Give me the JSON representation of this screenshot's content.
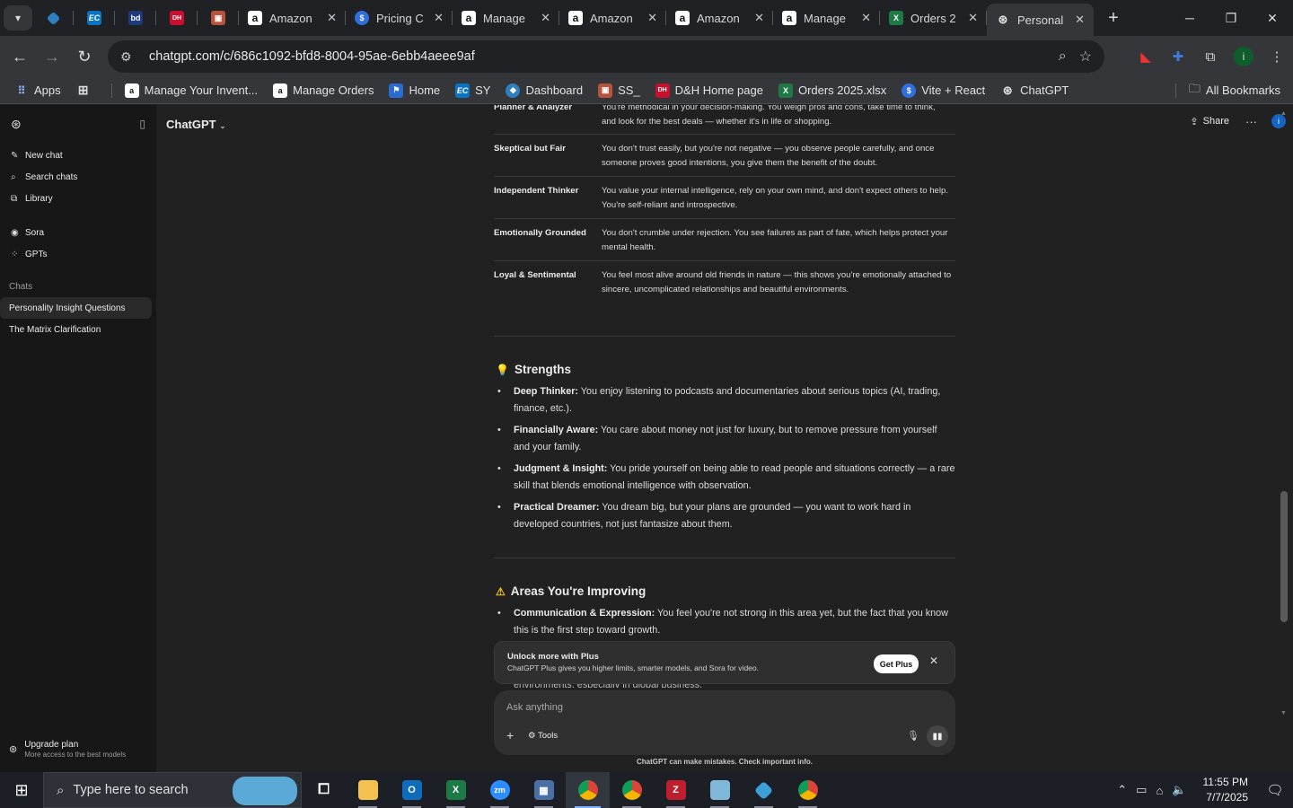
{
  "browser": {
    "tabs": [
      {
        "title": "Amazon",
        "icon": "amazon-icon"
      },
      {
        "title": "Pricing C",
        "icon": "dollar-icon"
      },
      {
        "title": "Manage",
        "icon": "amazon-icon"
      },
      {
        "title": "Amazon",
        "icon": "amazon-icon"
      },
      {
        "title": "Amazon",
        "icon": "amazon-icon"
      },
      {
        "title": "Manage",
        "icon": "amazon-icon"
      },
      {
        "title": "Orders 2",
        "icon": "excel-icon"
      },
      {
        "title": "Personal",
        "icon": "openai-icon",
        "active": true
      }
    ],
    "pinned_tabs": [
      "kite-icon",
      "ec-icon",
      "bd-icon",
      "dh-icon",
      "package-icon"
    ],
    "url": "chatgpt.com/c/686c1092-bfd8-8004-95ae-6ebb4aeee9af",
    "bookmarks": [
      {
        "label": "Apps",
        "icon": "apps-grid-icon"
      },
      {
        "label": "",
        "icon": "grid-icon"
      },
      {
        "label": "Manage Your Invent...",
        "icon": "amazon-icon"
      },
      {
        "label": "Manage Orders",
        "icon": "amazon-icon"
      },
      {
        "label": "Home",
        "icon": "home-flag-icon"
      },
      {
        "label": "SY",
        "icon": "ec-icon"
      },
      {
        "label": "Dashboard",
        "icon": "kite-icon"
      },
      {
        "label": "SS_",
        "icon": "package-icon"
      },
      {
        "label": "D&H Home page",
        "icon": "dh-icon"
      },
      {
        "label": "Orders 2025.xlsx",
        "icon": "excel-icon"
      },
      {
        "label": "Vite + React",
        "icon": "dollar-icon"
      },
      {
        "label": "ChatGPT",
        "icon": "openai-icon"
      }
    ],
    "all_bookmarks": "All Bookmarks",
    "profile_initial": "i"
  },
  "sidebar": {
    "items": [
      {
        "label": "New chat",
        "icon": "edit-icon"
      },
      {
        "label": "Search chats",
        "icon": "search-icon"
      },
      {
        "label": "Library",
        "icon": "library-icon"
      }
    ],
    "extras": [
      {
        "label": "Sora",
        "icon": "sora-icon"
      },
      {
        "label": "GPTs",
        "icon": "gpts-icon"
      }
    ],
    "chats_label": "Chats",
    "chats": [
      {
        "label": "Personality Insight Questions",
        "active": true
      },
      {
        "label": "The Matrix Clarification"
      }
    ],
    "upgrade_title": "Upgrade plan",
    "upgrade_sub": "More access to the best models"
  },
  "header": {
    "model": "ChatGPT",
    "share": "Share",
    "avatar": "i"
  },
  "traits": [
    {
      "name": "Planner & Analyzer",
      "desc": "You're methodical in your decision-making. You weigh pros and cons, take time to think, and look for the best deals — whether it's in life or shopping."
    },
    {
      "name": "Skeptical but Fair",
      "desc": "You don't trust easily, but you're not negative — you observe people carefully, and once someone proves good intentions, you give them the benefit of the doubt."
    },
    {
      "name": "Independent Thinker",
      "desc": "You value your internal intelligence, rely on your own mind, and don't expect others to help. You're self-reliant and introspective."
    },
    {
      "name": "Emotionally Grounded",
      "desc": "You don't crumble under rejection. You see failures as part of fate, which helps protect your mental health."
    },
    {
      "name": "Loyal & Sentimental",
      "desc": "You feel most alive around old friends in nature — this shows you're emotionally attached to sincere, uncomplicated relationships and beautiful environments."
    }
  ],
  "strengths": {
    "title": "Strengths",
    "emoji": "💡",
    "items": [
      {
        "label": "Deep Thinker:",
        "text": " You enjoy listening to podcasts and documentaries about serious topics (AI, trading, finance, etc.)."
      },
      {
        "label": "Financially Aware:",
        "text": " You care about money not just for luxury, but to remove pressure from yourself and your family."
      },
      {
        "label": "Judgment & Insight:",
        "text": " You pride yourself on being able to read people and situations correctly — a rare skill that blends emotional intelligence with observation."
      },
      {
        "label": "Practical Dreamer:",
        "text": " You dream big, but your plans are grounded — you want to work hard in developed countries, not just fantasize about them."
      }
    ]
  },
  "improving": {
    "title": "Areas You're Improving",
    "emoji": "⚠",
    "items": [
      {
        "label": "Communication & Expression:",
        "text": " You feel you're not strong in this area yet, but the fact that you know this is the first step toward growth."
      }
    ],
    "partial_text": "environments, especially in global business."
  },
  "promo": {
    "title": "Unlock more with Plus",
    "sub": "ChatGPT Plus gives you higher limits, smarter models, and Sora for video.",
    "button": "Get Plus"
  },
  "composer": {
    "placeholder": "Ask anything",
    "tools": "Tools",
    "disclaimer": "ChatGPT can make mistakes. Check important info."
  },
  "taskbar": {
    "search_placeholder": "Type here to search",
    "apps": [
      "task-view-icon",
      "file-explorer-icon",
      "outlook-icon",
      "excel-icon",
      "zoom-icon",
      "calculator-icon",
      "chrome-icon",
      "chrome-icon",
      "filezilla-icon",
      "notes-icon",
      "kite-icon",
      "chrome-icon"
    ],
    "time": "11:55 PM",
    "date": "7/7/2025"
  }
}
